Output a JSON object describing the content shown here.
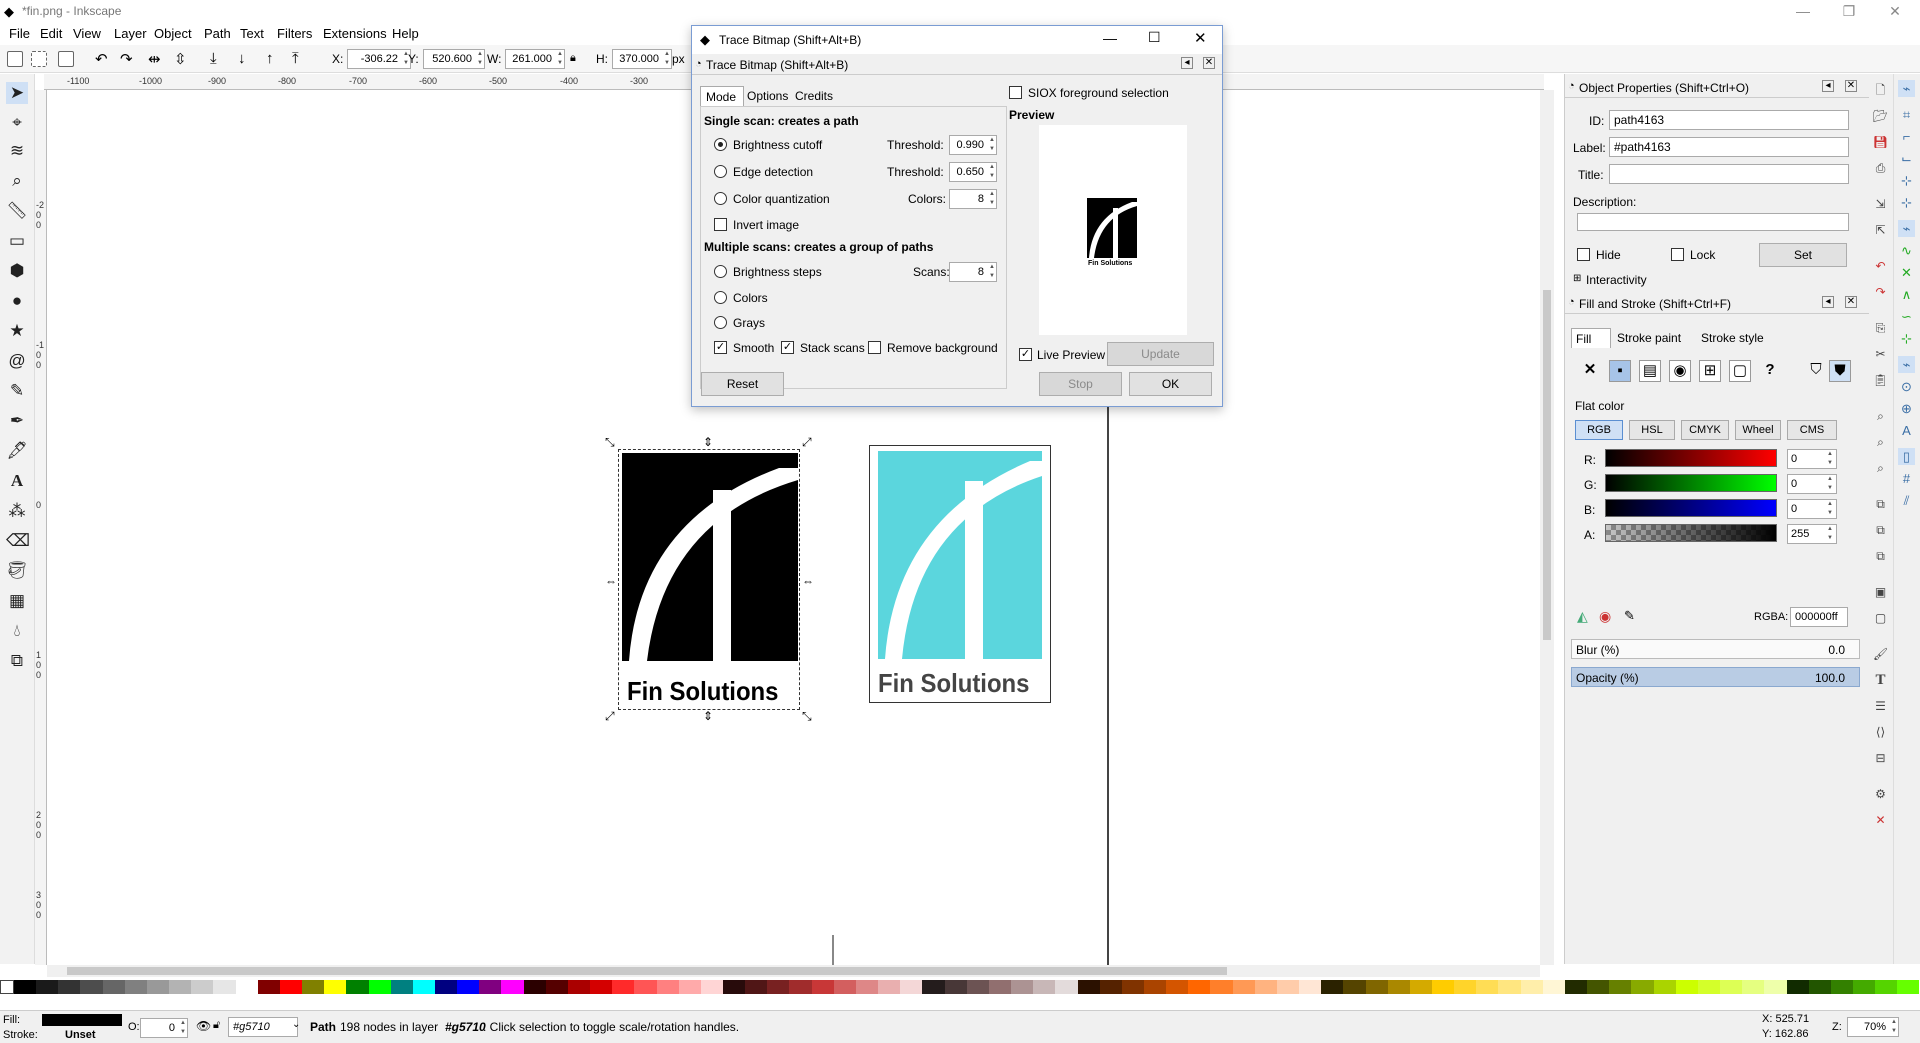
{
  "window": {
    "title": "*fin.png - Inkscape"
  },
  "menu": [
    "File",
    "Edit",
    "View",
    "Layer",
    "Object",
    "Path",
    "Text",
    "Filters",
    "Extensions",
    "Help"
  ],
  "toolbar": {
    "x_label": "X:",
    "x_value": "-306.22",
    "y_label": "Y:",
    "y_value": "520.600",
    "w_label": "W:",
    "w_value": "261.000",
    "h_label": "H:",
    "h_value": "370.000",
    "unit": "px"
  },
  "ruler": {
    "h_ticks": [
      "-1100",
      "-1000",
      "-900",
      "-800",
      "-700",
      "-600",
      "-500",
      "-400",
      "-300"
    ],
    "v_ticks": [
      "-200",
      "-100",
      "0",
      "100",
      "200",
      "300"
    ]
  },
  "canvas": {
    "logo_text": "Fin Solutions",
    "traced_color": "#000000",
    "original_color": "#5bd6dd"
  },
  "trace_dialog": {
    "title": "Trace Bitmap (Shift+Alt+B)",
    "subtitle": "Trace Bitmap (Shift+Alt+B)",
    "tabs": [
      "Mode",
      "Options",
      "Credits"
    ],
    "single_scan_heading": "Single scan: creates a path",
    "brightness_cutoff": "Brightness cutoff",
    "edge_detection": "Edge detection",
    "color_quantization": "Color quantization",
    "threshold_label": "Threshold:",
    "threshold1": "0.990",
    "threshold2": "0.650",
    "colors_label": "Colors:",
    "colors_value": "8",
    "invert_image": "Invert image",
    "multiple_scan_heading": "Multiple scans: creates a group of paths",
    "brightness_steps": "Brightness steps",
    "scans_label": "Scans:",
    "scans_value": "8",
    "colors_option": "Colors",
    "grays_option": "Grays",
    "smooth": "Smooth",
    "stack_scans": "Stack scans",
    "remove_background": "Remove background",
    "siox": "SIOX foreground selection",
    "preview_heading": "Preview",
    "preview_logo_text": "Fin Solutions",
    "live_preview": "Live Preview",
    "update": "Update",
    "reset": "Reset",
    "stop": "Stop",
    "ok": "OK"
  },
  "object_properties": {
    "title": "Object Properties (Shift+Ctrl+O)",
    "id_label": "ID:",
    "id_value": "path4163",
    "label_label": "Label:",
    "label_value": "#path4163",
    "title_label": "Title:",
    "title_value": "",
    "description_label": "Description:",
    "hide": "Hide",
    "lock": "Lock",
    "set": "Set",
    "interactivity": "Interactivity"
  },
  "fill_stroke": {
    "title": "Fill and Stroke (Shift+Ctrl+F)",
    "tabs": [
      "Fill",
      "Stroke paint",
      "Stroke style"
    ],
    "flat_color": "Flat color",
    "modes": [
      "RGB",
      "HSL",
      "CMYK",
      "Wheel",
      "CMS"
    ],
    "r_label": "R:",
    "r_value": "0",
    "g_label": "G:",
    "g_value": "0",
    "b_label": "B:",
    "b_value": "0",
    "a_label": "A:",
    "a_value": "255",
    "rgba_label": "RGBA:",
    "rgba_value": "000000ff",
    "blur_label": "Blur (%)",
    "blur_value": "0.0",
    "opacity_label": "Opacity (%)",
    "opacity_value": "100.0"
  },
  "status": {
    "fill_label": "Fill:",
    "stroke_label": "Stroke:",
    "stroke_value": "Unset",
    "o_label": "O:",
    "o_value": "0",
    "layer": "#g5710",
    "message_bold": "Path",
    "message_1": " 198 nodes in layer ",
    "message_layer": "#g5710",
    "message_2": ". Click selection to toggle scale/rotation handles.",
    "x_coord": "X:  525.71",
    "y_coord": "Y:  162.86",
    "z_label": "Z:",
    "zoom": "70%"
  }
}
